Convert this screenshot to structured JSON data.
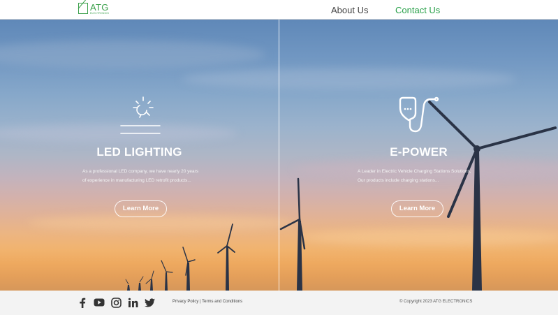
{
  "header": {
    "logo_name": "ATG",
    "logo_sub": "ELECTRONICS",
    "nav": {
      "about": "About Us",
      "contact": "Contact Us"
    }
  },
  "panels": [
    {
      "icon": "light-bulb-icon",
      "title": "LED LIGHTING",
      "desc": "As a professional LED company, we have nearly 20 years of experience in manufacturing LED retrofit products...",
      "button": "Learn More"
    },
    {
      "icon": "ev-charger-icon",
      "title": "E-POWER",
      "desc": "A Leader in Electric Vehicle Charging Stations Solutions, Our products include  charging stations...",
      "button": "Learn More"
    }
  ],
  "footer": {
    "social": [
      "facebook-icon",
      "youtube-icon",
      "instagram-icon",
      "linkedin-icon",
      "twitter-icon"
    ],
    "privacy": "Privacy Policy",
    "separator": " | ",
    "terms": "Terms and Conditions",
    "copyright": "© Copyright 2023 ATG ELECTRONICS"
  },
  "colors": {
    "brand_green": "#3aa04a",
    "nav_active": "#2aa14a",
    "footer_bg": "#f3f3f3"
  }
}
